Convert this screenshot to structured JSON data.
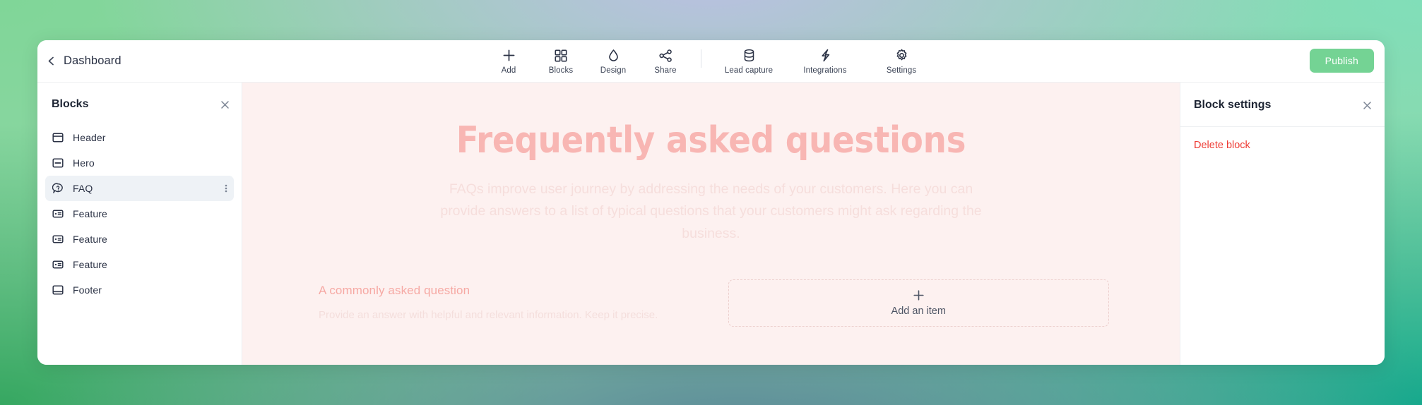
{
  "topbar": {
    "back_icon": "chevron-left-icon",
    "back_label": "Dashboard",
    "publish_label": "Publish",
    "tools": [
      {
        "icon": "plus-icon",
        "label": "Add"
      },
      {
        "icon": "grid-blocks-icon",
        "label": "Blocks"
      },
      {
        "icon": "droplet-icon",
        "label": "Design"
      },
      {
        "icon": "share-nodes-icon",
        "label": "Share"
      },
      {
        "icon": "database-icon",
        "label": "Lead capture"
      },
      {
        "icon": "bolt-icon",
        "label": "Integrations"
      },
      {
        "icon": "gear-icon",
        "label": "Settings"
      }
    ]
  },
  "sidebar": {
    "title": "Blocks",
    "close_icon": "close-icon",
    "items": [
      {
        "label": "Header",
        "icon": "header-block-icon",
        "selected": false
      },
      {
        "label": "Hero",
        "icon": "hero-block-icon",
        "selected": false
      },
      {
        "label": "FAQ",
        "icon": "faq-question-icon",
        "selected": true
      },
      {
        "label": "Feature",
        "icon": "feature-block-icon",
        "selected": false
      },
      {
        "label": "Feature",
        "icon": "feature-block-icon",
        "selected": false
      },
      {
        "label": "Feature",
        "icon": "feature-block-icon",
        "selected": false
      },
      {
        "label": "Footer",
        "icon": "footer-block-icon",
        "selected": false
      }
    ],
    "kebab_icon": "kebab-menu-icon"
  },
  "canvas": {
    "heading": "Frequently asked questions",
    "subheading": "FAQs improve user journey by addressing the needs of your customers. Here you can provide answers to a list of typical questions that your customers might ask regarding the business.",
    "faq_question": "A commonly asked question",
    "faq_answer": "Provide an answer with helpful and relevant information. Keep it precise.",
    "add_item_label": "Add an item",
    "add_item_icon": "plus-icon"
  },
  "block_settings": {
    "title": "Block settings",
    "close_icon": "close-icon",
    "delete_label": "Delete block"
  },
  "colors": {
    "publish_button": "#74d394",
    "canvas_background": "#fdf1f0",
    "heading_pink": "#f8b6b3",
    "question_pink": "#f6a9a4",
    "delete_red": "#ee3b34",
    "selected_row": "#eef2f6"
  }
}
